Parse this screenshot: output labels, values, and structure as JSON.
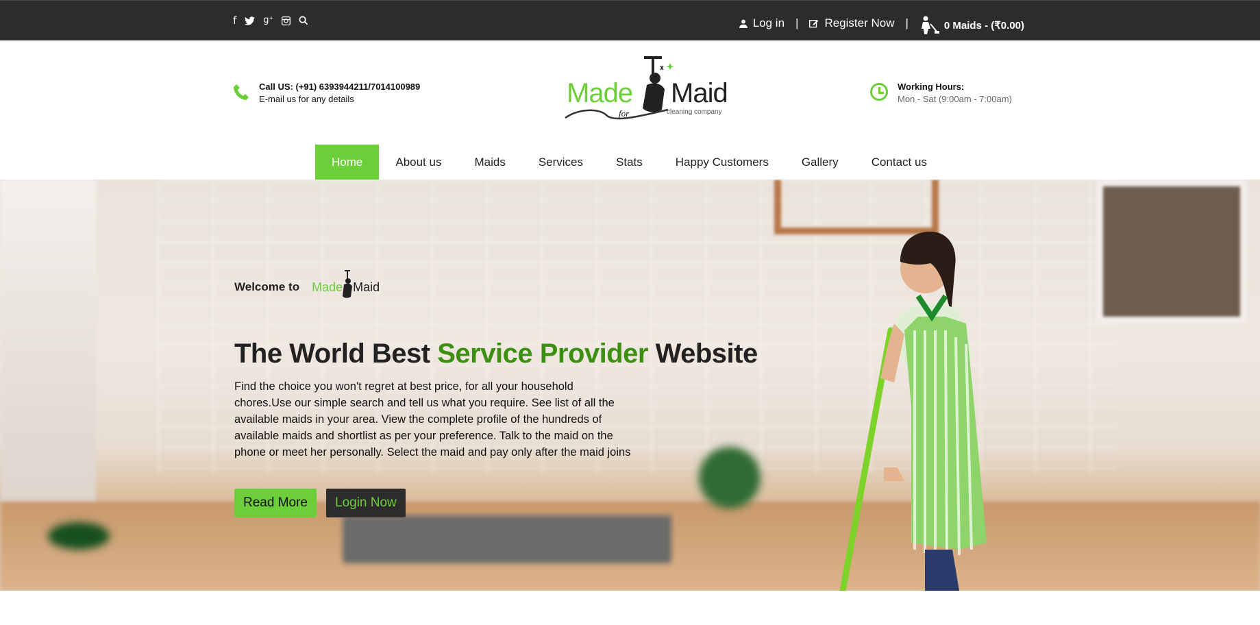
{
  "topbar": {
    "social_icons": [
      "facebook-icon",
      "twitter-icon",
      "google-plus-icon",
      "instagram-icon",
      "search-icon"
    ],
    "social_glyphs": [
      "f",
      "🐦",
      "g⁺",
      "◙",
      "⌕"
    ],
    "login_label": "Log in",
    "separator": "|",
    "register_label": "Register Now",
    "cart_label": "0 Maids - (₹0.00)"
  },
  "header": {
    "call_line": "Call US: (+91) 6393944211/7014100989",
    "email_line": "E-mail us for any details",
    "hours_title": "Working Hours:",
    "hours_value": "Mon - Sat (9:00am - 7:00am)",
    "logo_made": "Made",
    "logo_maid": "Maid",
    "logo_for": "for",
    "logo_tag": "cleaning company"
  },
  "nav": {
    "items": [
      "Home",
      "About us",
      "Maids",
      "Services",
      "Stats",
      "Happy Customers",
      "Gallery",
      "Contact us"
    ],
    "active": "Home"
  },
  "hero": {
    "welcome": "Welcome to",
    "mini_made": "Made",
    "mini_maid": "Maid",
    "headline_a": "The World Best ",
    "headline_green": "Service Provider",
    "headline_b": " Website",
    "description": "Find the choice you won't regret at best price, for all your household chores.Use our simple search and tell us what you require. See list of all the available maids in your area. View the complete profile of the hundreds of available maids and shortlist as per your preference. Talk to the maid on the phone or meet her personally. Select the maid and pay only after the maid joins",
    "read_more": "Read More",
    "login_now": "Login Now"
  },
  "colors": {
    "accent": "#6ccf3a",
    "dark": "#2c2c2c",
    "headline_green": "#3d8f12"
  }
}
